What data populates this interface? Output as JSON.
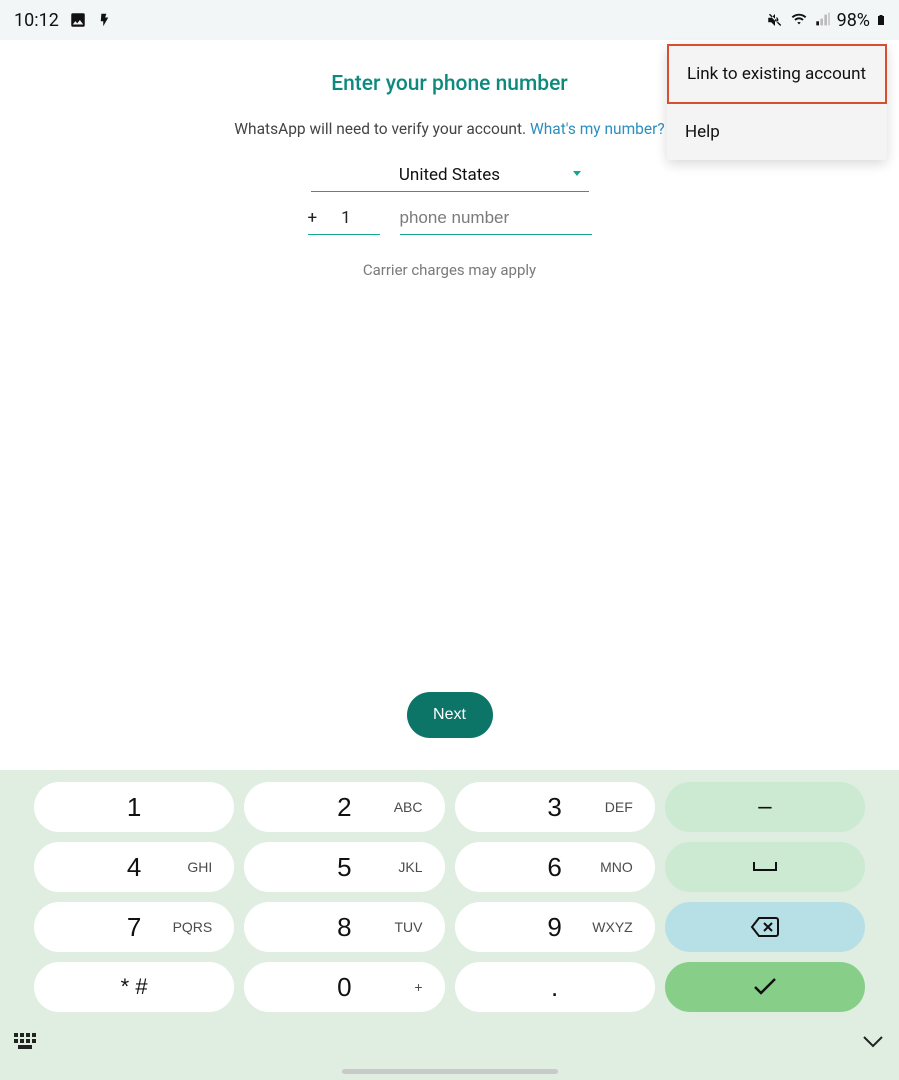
{
  "status": {
    "time": "10:12",
    "battery": "98%"
  },
  "page": {
    "title": "Enter your phone number",
    "subtitle_prefix": "WhatsApp will need to verify your account. ",
    "subtitle_link": "What's my number?",
    "country": "United States",
    "plus": "+",
    "country_code": "1",
    "phone_placeholder": "phone number",
    "carrier_note": "Carrier charges may apply",
    "next": "Next"
  },
  "menu": {
    "items": [
      {
        "label": "Link to existing account",
        "highlighted": true
      },
      {
        "label": "Help",
        "highlighted": false
      }
    ]
  },
  "keypad": {
    "rows": [
      [
        {
          "digit": "1",
          "letters": ""
        },
        {
          "digit": "2",
          "letters": "ABC"
        },
        {
          "digit": "3",
          "letters": "DEF"
        },
        {
          "action": "minus",
          "glyph": "–"
        }
      ],
      [
        {
          "digit": "4",
          "letters": "GHI"
        },
        {
          "digit": "5",
          "letters": "JKL"
        },
        {
          "digit": "6",
          "letters": "MNO"
        },
        {
          "action": "space",
          "glyph": "⎵"
        }
      ],
      [
        {
          "digit": "7",
          "letters": "PQRS"
        },
        {
          "digit": "8",
          "letters": "TUV"
        },
        {
          "digit": "9",
          "letters": "WXYZ"
        },
        {
          "action": "backspace",
          "glyph": "⌫"
        }
      ],
      [
        {
          "digit": "* #",
          "letters": ""
        },
        {
          "digit": "0",
          "letters": "+"
        },
        {
          "digit": ".",
          "letters": ""
        },
        {
          "action": "submit",
          "glyph": "✓"
        }
      ]
    ]
  }
}
